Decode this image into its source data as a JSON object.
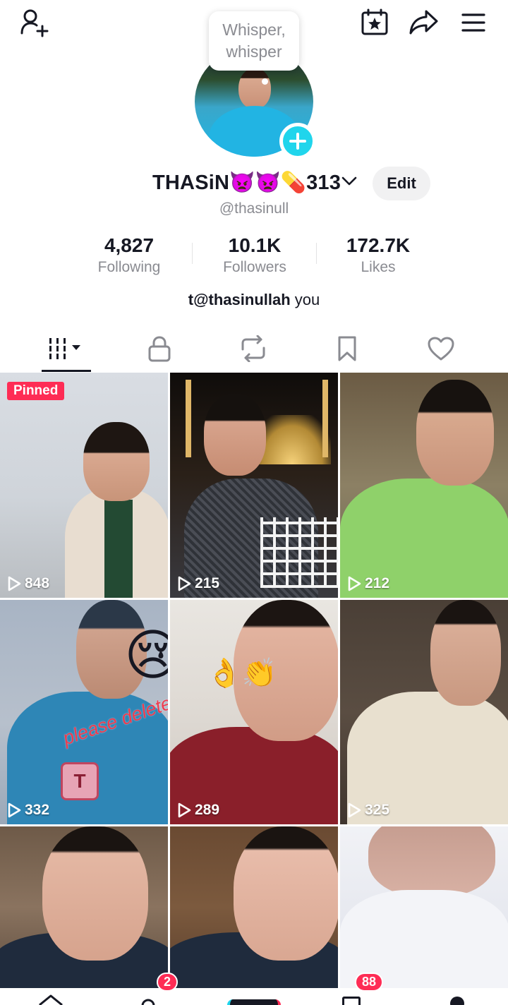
{
  "bubble": {
    "line1": "Whisper,",
    "line2": "whisper"
  },
  "profile": {
    "display_name": "THASiN👿👿💊313",
    "username": "@thasinull",
    "edit_label": "Edit",
    "bio_mention": "t@thasinullah",
    "bio_rest": " you"
  },
  "stats": [
    {
      "value": "4,827",
      "label": "Following"
    },
    {
      "value": "10.1K",
      "label": "Followers"
    },
    {
      "value": "172.7K",
      "label": "Likes"
    }
  ],
  "tabs": [
    "videos",
    "private",
    "reposts",
    "favorites",
    "liked"
  ],
  "videos": [
    {
      "views": "848",
      "pinned_label": "Pinned"
    },
    {
      "views": "215"
    },
    {
      "views": "212"
    },
    {
      "views": "332",
      "overlay_text": "please delete",
      "overlay_emoji": "😢"
    },
    {
      "views": "289",
      "overlay_emoji": "👌👏"
    },
    {
      "views": "325"
    },
    {
      "views": ""
    },
    {
      "views": ""
    },
    {
      "views": ""
    }
  ],
  "bottom_nav": {
    "inbox_badge": "2",
    "messages_badge": "88"
  },
  "colors": {
    "accent": "#fe2c55",
    "teal": "#20d5ec",
    "text": "#161823",
    "muted": "#8a8b91"
  }
}
